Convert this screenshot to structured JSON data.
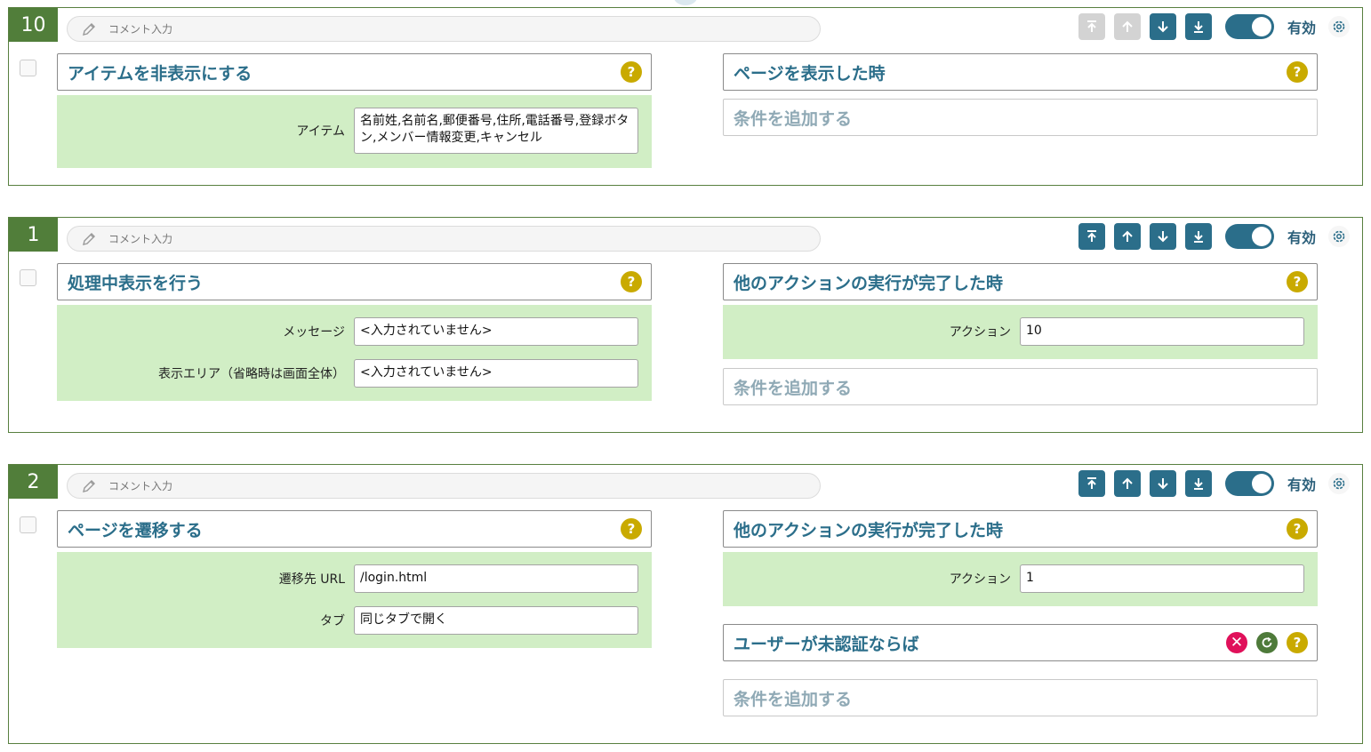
{
  "comment_placeholder": "コメント入力",
  "enabled_label": "有効",
  "cards": [
    {
      "number": "10",
      "action": {
        "title": "アイテムを非表示にする",
        "params": [
          {
            "label": "アイテム",
            "value": "名前姓,名前名,郵便番号,住所,電話番号,登録ボタン,メンバー情報変更,キャンセル"
          }
        ]
      },
      "trigger": {
        "title": "ページを表示した時"
      },
      "add_condition_label": "条件を追加する"
    },
    {
      "number": "1",
      "action": {
        "title": "処理中表示を行う",
        "params": [
          {
            "label": "メッセージ",
            "value": "<入力されていません>"
          },
          {
            "label": "表示エリア（省略時は画面全体）",
            "value": "<入力されていません>"
          }
        ]
      },
      "trigger": {
        "title": "他のアクションの実行が完了した時",
        "params": [
          {
            "label": "アクション",
            "value": "10"
          }
        ]
      },
      "add_condition_label": "条件を追加する"
    },
    {
      "number": "2",
      "action": {
        "title": "ページを遷移する",
        "params": [
          {
            "label": "遷移先 URL",
            "value": "/login.html"
          },
          {
            "label": "タブ",
            "value": "同じタブで開く"
          }
        ]
      },
      "trigger": {
        "title": "他のアクションの実行が完了した時",
        "params": [
          {
            "label": "アクション",
            "value": "1"
          }
        ]
      },
      "condition": {
        "title": "ユーザーが未認証ならば"
      },
      "add_condition_label": "条件を追加する"
    }
  ],
  "colors": {
    "accent": "#2b6e8a",
    "badge": "#517e3a",
    "panel": "#d1eec5",
    "help": "#c9aa00",
    "remove": "#e0105a"
  }
}
